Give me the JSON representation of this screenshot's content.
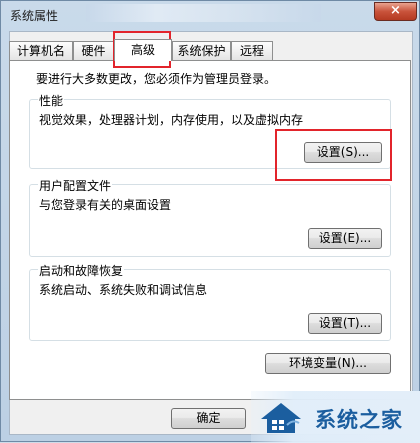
{
  "window": {
    "title": "系统属性",
    "close_glyph": "×"
  },
  "tabs": [
    {
      "label": "计算机名"
    },
    {
      "label": "硬件"
    },
    {
      "label": "高级"
    },
    {
      "label": "系统保护"
    },
    {
      "label": "远程"
    }
  ],
  "active_tab": "高级",
  "notice": "要进行大多数更改，您必须作为管理员登录。",
  "groups": {
    "performance": {
      "legend": "性能",
      "desc": "视觉效果，处理器计划，内存使用，以及虚拟内存",
      "button": "设置(S)..."
    },
    "profile": {
      "legend": "用户配置文件",
      "desc": "与您登录有关的桌面设置",
      "button": "设置(E)..."
    },
    "startup": {
      "legend": "启动和故障恢复",
      "desc": "系统启动、系统失败和调试信息",
      "button": "设置(T)..."
    }
  },
  "env_button": "环境变量(N)...",
  "footer": {
    "ok_button": "确定"
  },
  "watermark": {
    "text": "系统之家"
  },
  "colors": {
    "highlight": "#e2242b",
    "watermark_text": "#1b5e9f"
  }
}
